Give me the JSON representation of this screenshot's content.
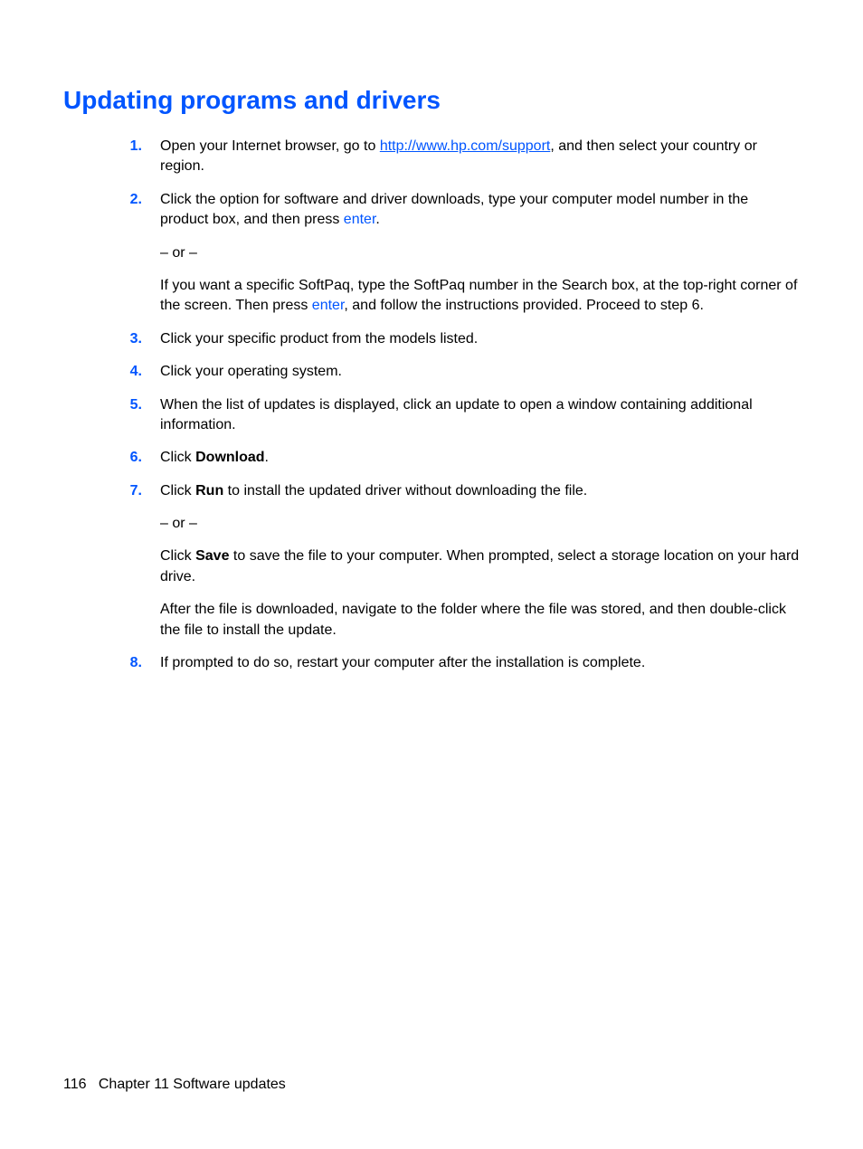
{
  "heading": "Updating programs and drivers",
  "steps": {
    "s1_a": "Open your Internet browser, go to ",
    "s1_link": "http://www.hp.com/support",
    "s1_b": ", and then select your country or region.",
    "s2_a": "Click the option for software and driver downloads, type your computer model number in the product box, and then press ",
    "s2_enter": "enter",
    "s2_b": ".",
    "s2_or": "– or –",
    "s2_c": "If you want a specific SoftPaq, type the SoftPaq number in the Search box, at the top-right corner of the screen. Then press ",
    "s2_enter2": "enter",
    "s2_d": ", and follow the instructions provided. Proceed to step 6.",
    "s3": "Click your specific product from the models listed.",
    "s4": "Click your operating system.",
    "s5": "When the list of updates is displayed, click an update to open a window containing additional information.",
    "s6_a": "Click ",
    "s6_bold": "Download",
    "s6_b": ".",
    "s7_a": "Click ",
    "s7_bold": "Run",
    "s7_b": " to install the updated driver without downloading the file.",
    "s7_or": "– or –",
    "s7_c": "Click ",
    "s7_bold2": "Save",
    "s7_d": " to save the file to your computer. When prompted, select a storage location on your hard drive.",
    "s7_e": "After the file is downloaded, navigate to the folder where the file was stored, and then double-click the file to install the update.",
    "s8": "If prompted to do so, restart your computer after the installation is complete."
  },
  "nums": {
    "n1": "1.",
    "n2": "2.",
    "n3": "3.",
    "n4": "4.",
    "n5": "5.",
    "n6": "6.",
    "n7": "7.",
    "n8": "8."
  },
  "footer": {
    "page": "116",
    "chapter": "Chapter 11   Software updates"
  }
}
